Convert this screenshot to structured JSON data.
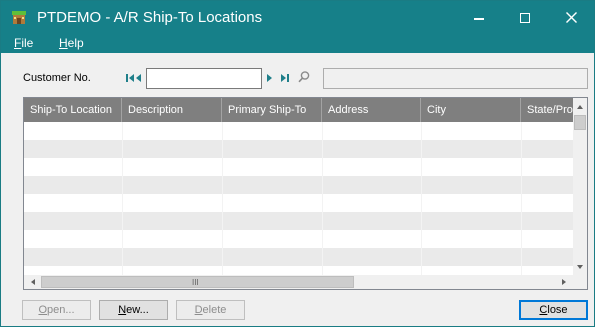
{
  "window": {
    "title": "PTDEMO - A/R Ship-To Locations",
    "accent": "#168089"
  },
  "menu": {
    "file": {
      "accel": "F",
      "rest": "ile"
    },
    "help": {
      "accel": "H",
      "rest": "elp"
    }
  },
  "customer": {
    "label": "Customer No.",
    "value": "",
    "name": ""
  },
  "grid": {
    "columns": [
      {
        "label": "Ship-To Location"
      },
      {
        "label": "Description"
      },
      {
        "label": "Primary Ship-To"
      },
      {
        "label": "Address"
      },
      {
        "label": "City"
      },
      {
        "label": "State/Pro"
      }
    ],
    "rows": [],
    "hscroll_grip": "III",
    "header_bg": "#7f7f7f",
    "row_alt_bg": "#eaeaea"
  },
  "buttons": {
    "open": {
      "accel": "O",
      "rest": "pen..."
    },
    "new": {
      "accel": "N",
      "rest": "ew..."
    },
    "delete": {
      "accel": "D",
      "rest": "elete"
    },
    "close": {
      "accel": "C",
      "rest": "lose"
    }
  }
}
